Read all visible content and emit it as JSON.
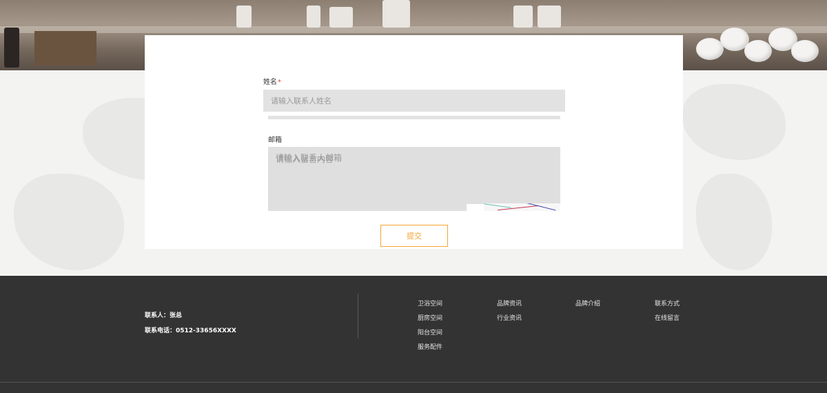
{
  "form": {
    "name_label": "姓名",
    "name_required_mark": "*",
    "name_placeholder": "请输入联系人姓名",
    "email_label": "邮箱",
    "email_placeholder": "请输入联系人邮箱",
    "message_placeholder": "请输入留言内容",
    "submit_label": "提交"
  },
  "footer": {
    "contact_person": "联系人：张总",
    "contact_phone": "联系电话：0512-33656XXXX",
    "nav_columns": [
      {
        "items": [
          "卫浴空间",
          "厨房空间",
          "阳台空间",
          "服务配件"
        ]
      },
      {
        "items": [
          "品牌资讯",
          "行业资讯"
        ]
      },
      {
        "items": [
          "品牌介绍"
        ]
      },
      {
        "items": [
          "联系方式",
          "在线留言"
        ]
      }
    ]
  },
  "colors": {
    "accent": "#f2a533",
    "required": "#e0462c",
    "footer_bg": "#333333",
    "input_bg": "#e3e2e2"
  }
}
